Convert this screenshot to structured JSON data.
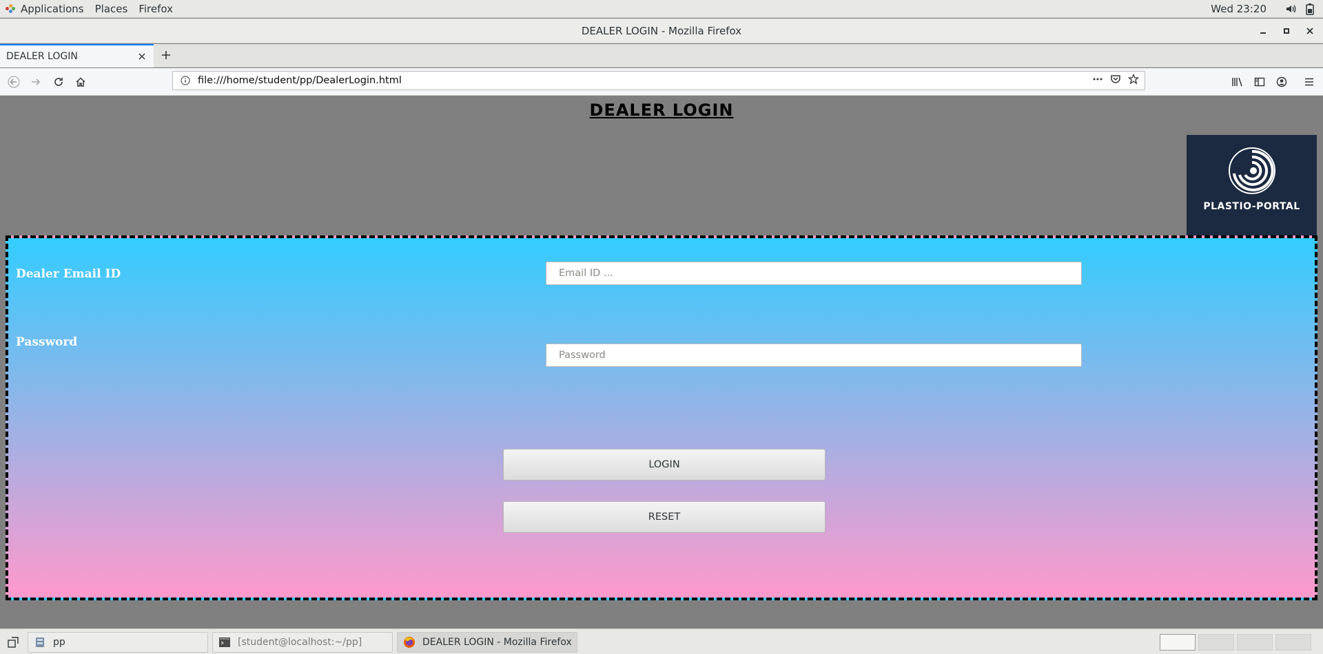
{
  "topbar": {
    "applications": "Applications",
    "places": "Places",
    "firefox": "Firefox",
    "clock": "Wed 23:20",
    "icons": [
      "volume-icon",
      "battery-icon"
    ]
  },
  "window": {
    "title": "DEALER LOGIN - Mozilla Firefox"
  },
  "tabs": [
    {
      "label": "DEALER LOGIN",
      "active": true
    }
  ],
  "navbar": {
    "url": "file:///home/student/pp/DealerLogin.html"
  },
  "page": {
    "heading": "DEALER LOGIN",
    "logo_text": "PLASTIO-PORTAL",
    "email_label": "Dealer Email ID",
    "email_placeholder": "Email ID ...",
    "email_value": "",
    "password_label": "Password",
    "password_placeholder": "Password",
    "password_value": "",
    "login_label": "LOGIN",
    "reset_label": "RESET",
    "colors": {
      "background": "#808080",
      "gradient_top": "#33ccff",
      "gradient_bottom": "#ff99cc",
      "logo_bg": "#1b2a41"
    }
  },
  "taskbar": {
    "items": [
      {
        "label": "pp",
        "icon": "file-manager-icon"
      },
      {
        "label": "[student@localhost:~/pp]",
        "icon": "terminal-icon"
      },
      {
        "label": "DEALER LOGIN - Mozilla Firefox",
        "icon": "firefox-icon",
        "active": true
      }
    ],
    "workspaces": 4,
    "active_workspace": 1
  }
}
